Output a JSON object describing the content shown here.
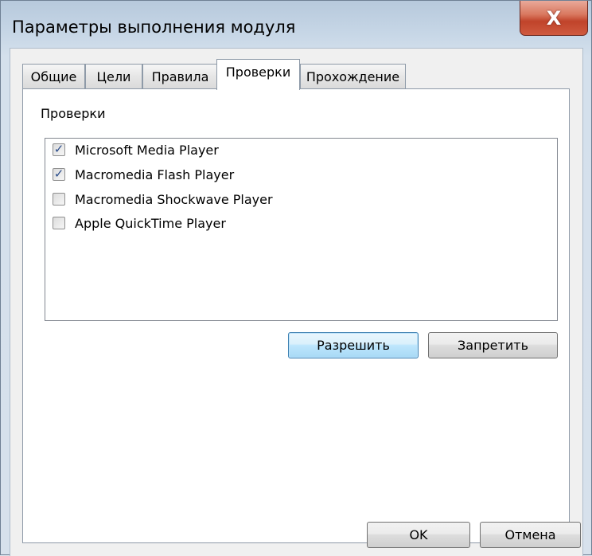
{
  "window": {
    "title": "Параметры выполнения модуля",
    "close_label": "X"
  },
  "tabs": [
    {
      "label": "Общие",
      "active": false
    },
    {
      "label": "Цели",
      "active": false
    },
    {
      "label": "Правила",
      "active": false
    },
    {
      "label": "Проверки",
      "active": true
    },
    {
      "label": "Прохождение",
      "active": false
    }
  ],
  "checks": {
    "group_label": "Проверки",
    "items": [
      {
        "label": "Microsoft Media Player",
        "checked": true
      },
      {
        "label": "Macromedia Flash Player",
        "checked": true
      },
      {
        "label": "Macromedia Shockwave Player",
        "checked": false
      },
      {
        "label": "Apple QuickTime Player",
        "checked": false
      }
    ],
    "allow_label": "Разрешить",
    "deny_label": "Запретить"
  },
  "footer": {
    "ok_label": "OK",
    "cancel_label": "Отмена"
  },
  "icons": {
    "checkmark": "✓"
  }
}
